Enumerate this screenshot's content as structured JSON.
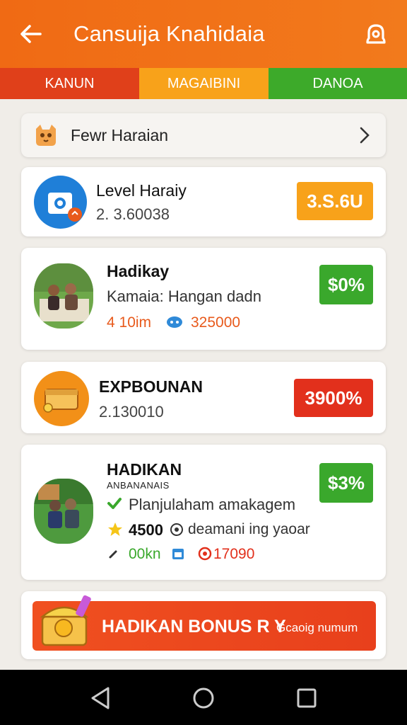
{
  "header": {
    "title": "Cansuija Knahidaia"
  },
  "tabs": [
    {
      "label": "KANUN"
    },
    {
      "label": "MAGAIBINI"
    },
    {
      "label": "DANOA"
    }
  ],
  "filter": {
    "label": "Fewr Haraian"
  },
  "cards": [
    {
      "name": "Level Haraiy",
      "sub": "2. 3.60038",
      "badge": "3.S.6U",
      "badge_color": "#f8a21a"
    },
    {
      "name": "Hadikay",
      "sub": "Kamaia: Hangan dadn",
      "stat1": "4 10im",
      "stat2": "325000",
      "badge": "$0%",
      "badge_color": "#3aa82c"
    },
    {
      "name": "EXPBOUNAN",
      "sub": "2.130010",
      "badge": "3900%",
      "badge_color": "#e2301c"
    },
    {
      "name": "HADIKAN",
      "subtitle": "ANBANANAIS",
      "line1": "Planjulaham amakagem",
      "line2_value": "4500",
      "line2_text": "deamani ing yaoar",
      "stat1": "00kn",
      "stat2": "17090",
      "badge": "$3%",
      "badge_color": "#3aa82c"
    }
  ],
  "banner": {
    "main": "HADIKAN BONUS",
    "arrow": "R Y",
    "sub": "Gcaoig numum"
  },
  "colors": {
    "primary": "#f06a14",
    "tab_red": "#e0401a",
    "tab_orange": "#f8a21a",
    "tab_green": "#3daa2a"
  }
}
